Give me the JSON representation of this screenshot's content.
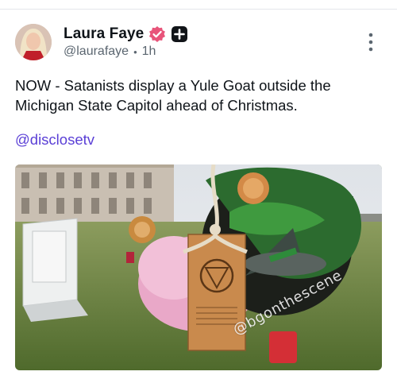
{
  "post": {
    "author_name": "Laura Faye",
    "handle": "@laurafaye",
    "time": "1h",
    "text": "NOW - Satanists display a Yule Goat outside the Michigan State Capitol ahead of Christmas.",
    "mention": "@disclosetv"
  },
  "media": {
    "watermark": "@bgonthescene"
  },
  "icons": {
    "verified": "verified-badge-icon",
    "plus": "plus-badge-icon",
    "more": "more-vertical-icon"
  },
  "colors": {
    "verified": "#e8547a",
    "link": "#5a3fd6",
    "muted": "#5b6670"
  }
}
